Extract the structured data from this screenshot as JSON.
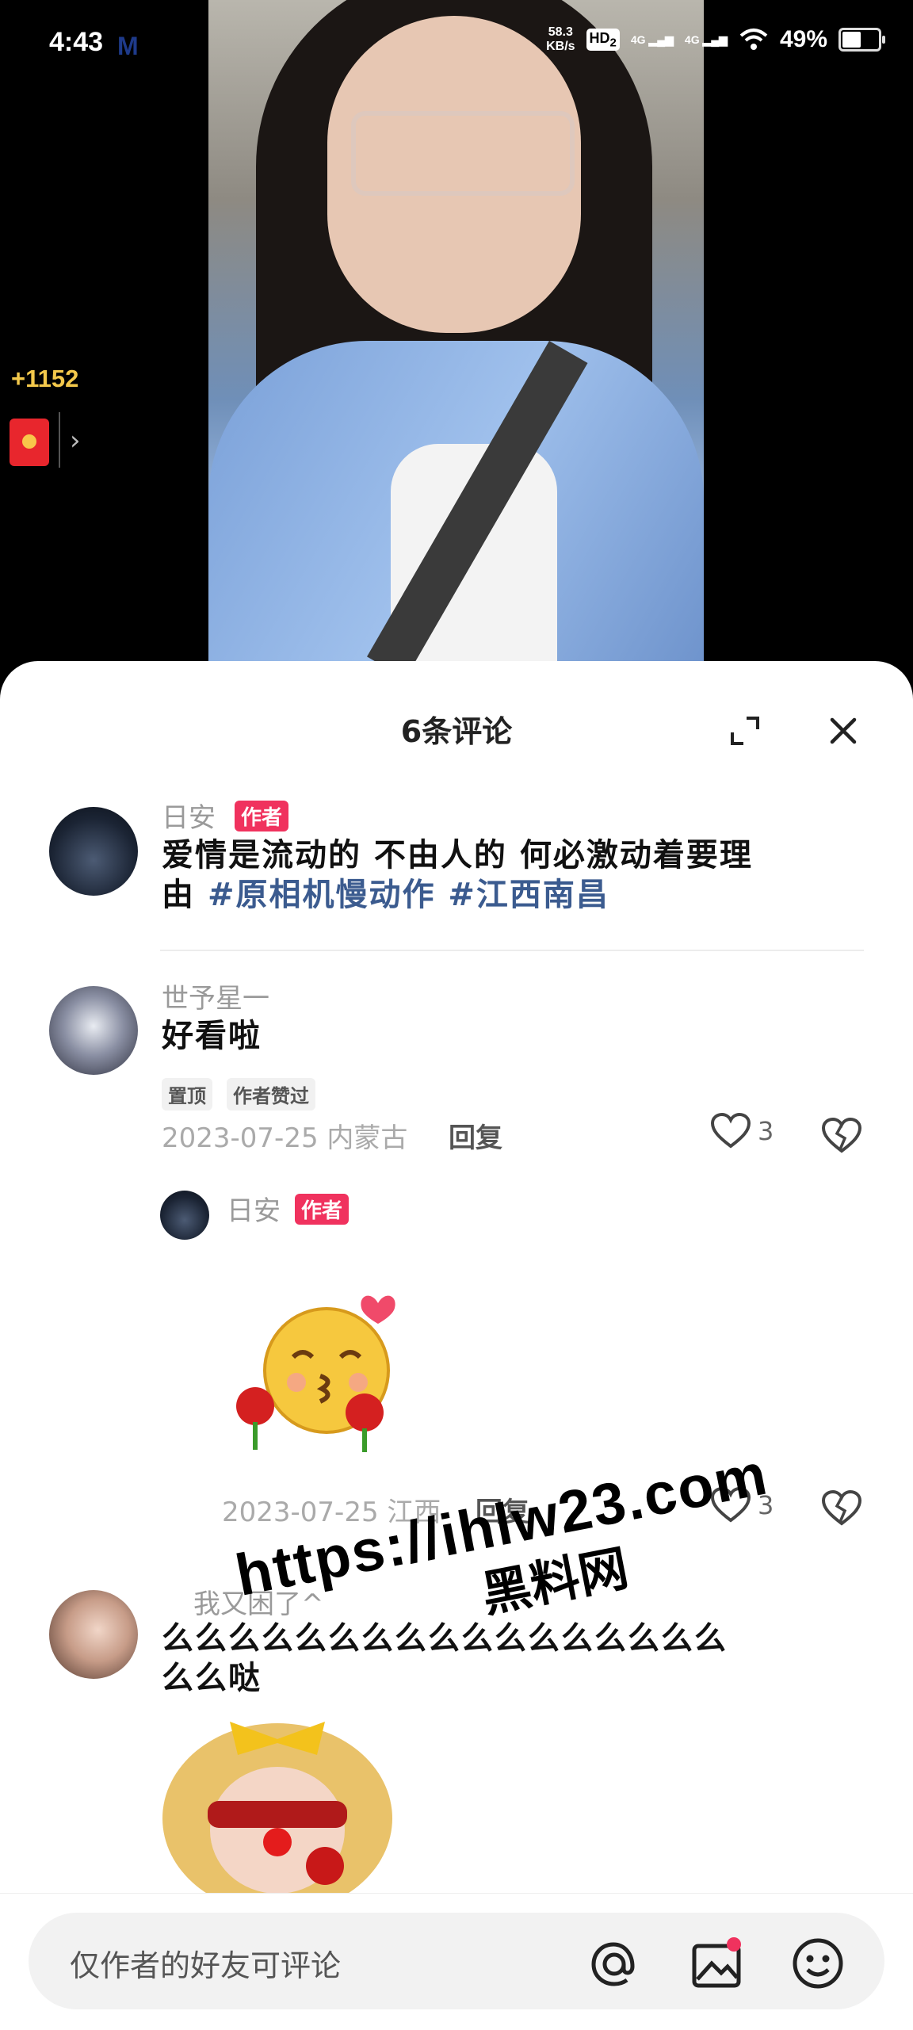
{
  "status_bar": {
    "time": "4:43",
    "app_logo": "M",
    "net_speed_value": "58.3",
    "net_speed_unit": "KB/s",
    "hd_label": "HD",
    "hd_sub": "2",
    "sig1": "4G",
    "sig2": "4G",
    "battery": "49%"
  },
  "reward": {
    "coins": "+1152"
  },
  "comments_header": {
    "title": "6条评论"
  },
  "post": {
    "author": "日安",
    "author_badge": "作者",
    "text_line1": "爱情是流动的 不由人的 何必激动着要理",
    "text_line2_prefix": "由 ",
    "hashtag1": "#原相机慢动作",
    "hashtag2": " #江西南昌"
  },
  "comments": [
    {
      "user": "世予星一",
      "text": "好看啦",
      "tags": [
        "置顶",
        "作者赞过"
      ],
      "meta": "2023-07-25 内蒙古",
      "reply_label": "回复",
      "likes": "3"
    }
  ],
  "reply": {
    "user": "日安",
    "badge": "作者",
    "meta": "2023-07-25 江西",
    "reply_label": "回复",
    "likes": "3"
  },
  "comment3": {
    "user": "我又困了^",
    "text_line1": "么么么么么么么么么么么么么么么么么",
    "text_line2": "么么哒"
  },
  "watermark": {
    "url": "https://ihlw23.com",
    "name": "黑料网"
  },
  "input_bar": {
    "placeholder": "仅作者的好友可评论"
  }
}
